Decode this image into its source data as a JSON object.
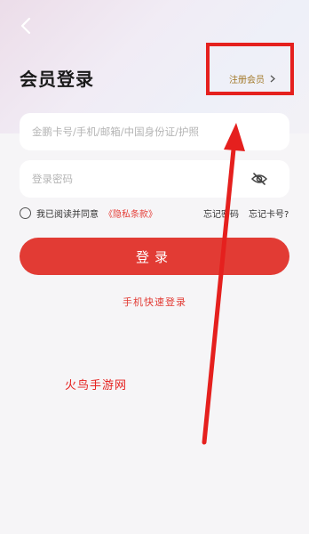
{
  "header": {
    "back_icon": "chevron-left-icon",
    "title": "会员登录",
    "register_label": "注册会员",
    "register_icon": "chevron-right-icon"
  },
  "form": {
    "account_placeholder": "金鹏卡号/手机/邮箱/中国身份证/护照",
    "password_placeholder": "登录密码",
    "eye_icon": "eye-off-icon"
  },
  "agreement": {
    "prefix": "我已阅读并同意",
    "policy_link": "《隐私条款》",
    "forgot_password": "忘记密码",
    "forgot_card": "忘记卡号?"
  },
  "actions": {
    "login_label": "登录",
    "quick_login": "手机快速登录"
  },
  "annotation": {
    "watermark": "火鸟手游网",
    "highlight_color": "#e5201e"
  },
  "colors": {
    "accent": "#e23b34",
    "gold": "#a3792a"
  }
}
